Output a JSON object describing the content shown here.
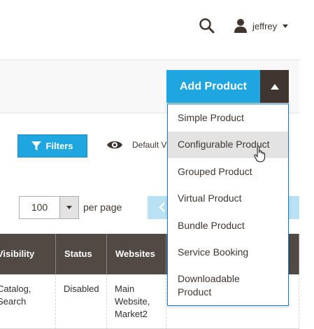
{
  "header": {
    "username": "jeffrey"
  },
  "actions": {
    "add_product_label": "Add Product",
    "add_product_menu": [
      "Simple Product",
      "Configurable Product",
      "Grouped Product",
      "Virtual Product",
      "Bundle Product",
      "Service Booking",
      "Downloadable Product"
    ],
    "hovered_item": "Configurable Product"
  },
  "toolbar": {
    "filters_label": "Filters",
    "view_label": "Default V",
    "per_page_value": "100",
    "per_page_label": "per page"
  },
  "grid": {
    "columns": [
      "Visibility",
      "Status",
      "Websites",
      ""
    ],
    "rows": [
      {
        "visibility": "Catalog, Search",
        "status": "Disabled",
        "websites": "Main Website, Market2"
      }
    ]
  },
  "colors": {
    "primary_button": "#1fa5e0",
    "toggle_dark": "#41362f",
    "grid_header": "#514943",
    "dropdown_border": "#1979c3"
  }
}
